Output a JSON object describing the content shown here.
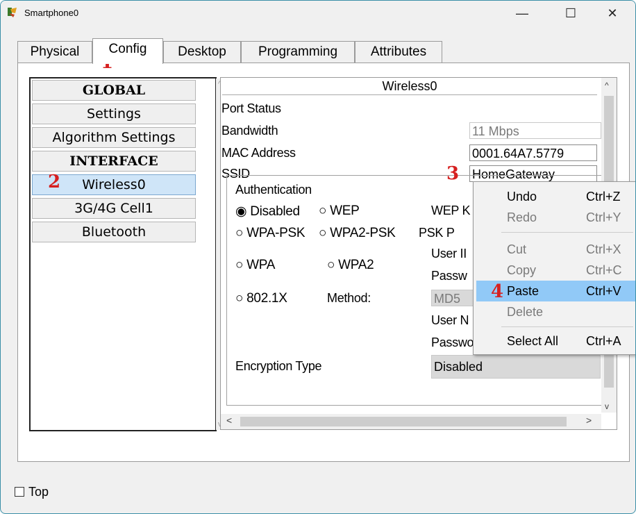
{
  "window": {
    "title": "Smartphone0",
    "minimize_glyph": "—",
    "maximize_glyph": "☐",
    "close_glyph": "✕"
  },
  "tabs": [
    {
      "label": "Physical"
    },
    {
      "label": "Config"
    },
    {
      "label": "Desktop"
    },
    {
      "label": "Programming"
    },
    {
      "label": "Attributes"
    }
  ],
  "left_nav": {
    "items": [
      {
        "label": "GLOBAL"
      },
      {
        "label": "Settings"
      },
      {
        "label": "Algorithm Settings"
      },
      {
        "label": "INTERFACE"
      },
      {
        "label": "Wireless0"
      },
      {
        "label": "3G/4G Cell1"
      },
      {
        "label": "Bluetooth"
      }
    ]
  },
  "interface": {
    "title": "Wireless0",
    "port_status_label": "Port Status",
    "bandwidth_label": "Bandwidth",
    "bandwidth_value": "11 Mbps",
    "mac_label": "MAC Address",
    "mac_value": "0001.64A7.5779",
    "ssid_label": "SSID",
    "ssid_value": "HomeGateway",
    "auth": {
      "title": "Authentication",
      "disabled": "Disabled",
      "wep": "WEP",
      "wep_key": "WEP K",
      "wpa_psk": "WPA-PSK",
      "wpa2_psk": "WPA2-PSK",
      "psk_pass": "PSK P",
      "user_id": "User II",
      "wpa": "WPA",
      "wpa2": "WPA2",
      "password_short": "Passw",
      "dot1x": "802.1X",
      "method_label": "Method:",
      "method_value": "MD5",
      "user_name": "User N",
      "password": "Password",
      "enc_label": "Encryption Type",
      "enc_value": "Disabled"
    }
  },
  "context_menu": {
    "items": [
      {
        "label": "Undo",
        "shortcut": "Ctrl+Z"
      },
      {
        "label": "Redo",
        "shortcut": "Ctrl+Y"
      },
      {
        "label": "Cut",
        "shortcut": "Ctrl+X"
      },
      {
        "label": "Copy",
        "shortcut": "Ctrl+C"
      },
      {
        "label": "Paste",
        "shortcut": "Ctrl+V"
      },
      {
        "label": "Delete",
        "shortcut": ""
      },
      {
        "label": "Select All",
        "shortcut": "Ctrl+A"
      }
    ]
  },
  "markers": [
    "1",
    "2",
    "3",
    "4"
  ],
  "footer": {
    "top_label": "Top"
  },
  "colors": {
    "marker": "#d62020",
    "selection": "#cfe5f8",
    "menu_highlight": "#91c9f7",
    "window_border": "#3a8fa7"
  }
}
